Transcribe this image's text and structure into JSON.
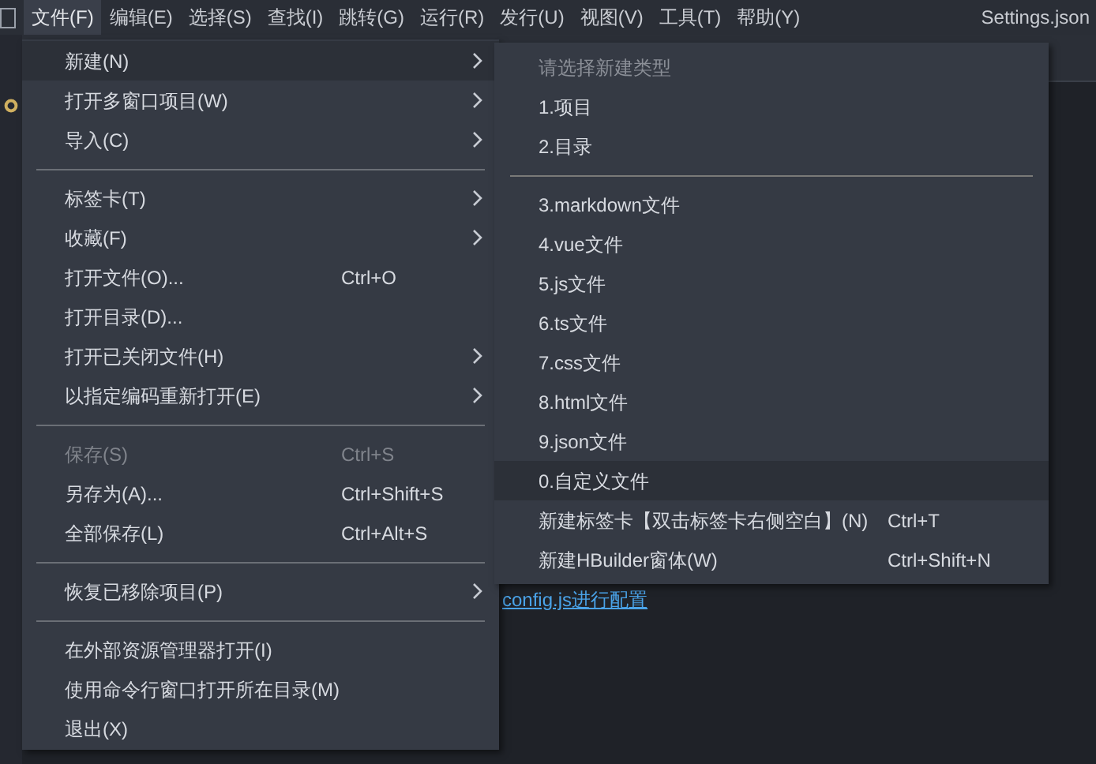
{
  "menubar": [
    {
      "label": "文件(F)",
      "selected": true
    },
    {
      "label": "编辑(E)",
      "selected": false
    },
    {
      "label": "选择(S)",
      "selected": false
    },
    {
      "label": "查找(I)",
      "selected": false
    },
    {
      "label": "跳转(G)",
      "selected": false
    },
    {
      "label": "运行(R)",
      "selected": false
    },
    {
      "label": "发行(U)",
      "selected": false
    },
    {
      "label": "视图(V)",
      "selected": false
    },
    {
      "label": "工具(T)",
      "selected": false
    },
    {
      "label": "帮助(Y)",
      "selected": false
    }
  ],
  "window": {
    "title": "Settings.json"
  },
  "editor": {
    "link": "config.js进行配置"
  },
  "file_menu": [
    {
      "kind": "item",
      "label": "新建(N)",
      "submenu": true,
      "selected": true,
      "disabled": false
    },
    {
      "kind": "item",
      "label": "打开多窗口项目(W)",
      "submenu": true,
      "selected": false,
      "disabled": false
    },
    {
      "kind": "item",
      "label": "导入(C)",
      "submenu": true,
      "selected": false,
      "disabled": false
    },
    {
      "kind": "separator"
    },
    {
      "kind": "item",
      "label": "标签卡(T)",
      "submenu": true,
      "selected": false,
      "disabled": false
    },
    {
      "kind": "item",
      "label": "收藏(F)",
      "submenu": true,
      "selected": false,
      "disabled": false
    },
    {
      "kind": "item",
      "label": "打开文件(O)...",
      "shortcut": "Ctrl+O",
      "submenu": false,
      "selected": false,
      "disabled": false
    },
    {
      "kind": "item",
      "label": "打开目录(D)...",
      "submenu": false,
      "selected": false,
      "disabled": false
    },
    {
      "kind": "item",
      "label": "打开已关闭文件(H)",
      "submenu": true,
      "selected": false,
      "disabled": false
    },
    {
      "kind": "item",
      "label": "以指定编码重新打开(E)",
      "submenu": true,
      "selected": false,
      "disabled": false
    },
    {
      "kind": "separator"
    },
    {
      "kind": "item",
      "label": "保存(S)",
      "shortcut": "Ctrl+S",
      "submenu": false,
      "selected": false,
      "disabled": true
    },
    {
      "kind": "item",
      "label": "另存为(A)...",
      "shortcut": "Ctrl+Shift+S",
      "submenu": false,
      "selected": false,
      "disabled": false
    },
    {
      "kind": "item",
      "label": "全部保存(L)",
      "shortcut": "Ctrl+Alt+S",
      "submenu": false,
      "selected": false,
      "disabled": false
    },
    {
      "kind": "separator"
    },
    {
      "kind": "item",
      "label": "恢复已移除项目(P)",
      "submenu": true,
      "selected": false,
      "disabled": false
    },
    {
      "kind": "separator"
    },
    {
      "kind": "item",
      "label": "在外部资源管理器打开(I)",
      "submenu": false,
      "selected": false,
      "disabled": false
    },
    {
      "kind": "item",
      "label": "使用命令行窗口打开所在目录(M)",
      "submenu": false,
      "selected": false,
      "disabled": false
    },
    {
      "kind": "item",
      "label": "退出(X)",
      "submenu": false,
      "selected": false,
      "disabled": false
    }
  ],
  "new_submenu": [
    {
      "kind": "header",
      "label": "请选择新建类型"
    },
    {
      "kind": "item",
      "label": "1.项目",
      "selected": false
    },
    {
      "kind": "item",
      "label": "2.目录",
      "selected": false
    },
    {
      "kind": "separator"
    },
    {
      "kind": "item",
      "label": "3.markdown文件",
      "selected": false
    },
    {
      "kind": "item",
      "label": "4.vue文件",
      "selected": false
    },
    {
      "kind": "item",
      "label": "5.js文件",
      "selected": false
    },
    {
      "kind": "item",
      "label": "6.ts文件",
      "selected": false
    },
    {
      "kind": "item",
      "label": "7.css文件",
      "selected": false
    },
    {
      "kind": "item",
      "label": "8.html文件",
      "selected": false
    },
    {
      "kind": "item",
      "label": "9.json文件",
      "selected": false
    },
    {
      "kind": "item",
      "label": "0.自定义文件",
      "selected": true
    },
    {
      "kind": "item",
      "label": "新建标签卡【双击标签卡右侧空白】(N)",
      "shortcut": "Ctrl+T",
      "selected": false
    },
    {
      "kind": "item",
      "label": "新建HBuilder窗体(W)",
      "shortcut": "Ctrl+Shift+N",
      "selected": false
    }
  ]
}
